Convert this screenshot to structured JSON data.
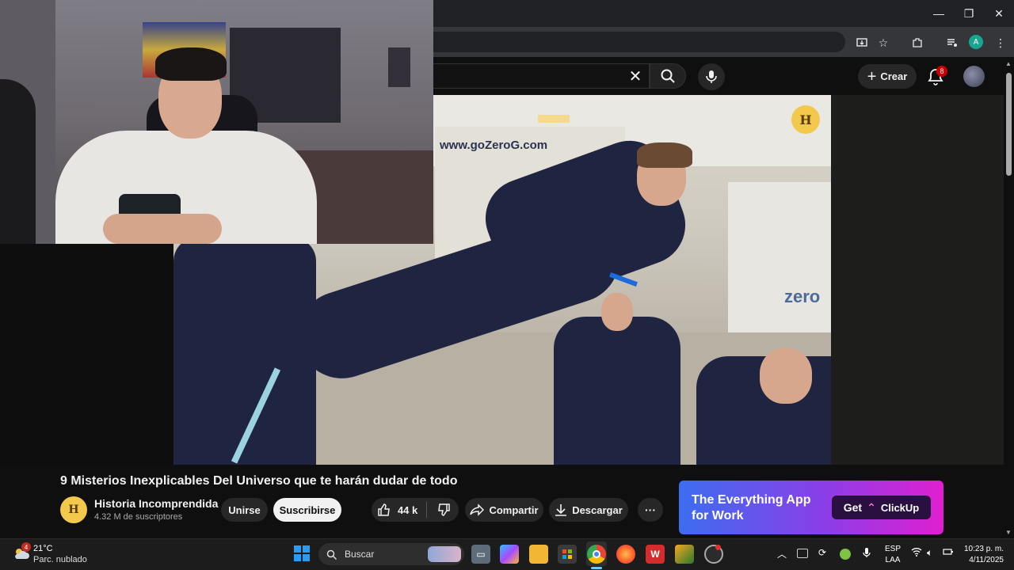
{
  "browser": {
    "controls": [
      "—",
      "❐",
      "✕"
    ],
    "profile_initial": "A"
  },
  "youtube": {
    "create_label": "Crear",
    "notif_count": "8",
    "video_title": "9 Misterios Inexplicables Del Universo que te harán dudar de todo",
    "channel": {
      "name": "Historia Incomprendida",
      "subs": "4.32 M de suscriptores",
      "avatar_letter": "H",
      "join_label": "Unirse",
      "subscribe_label": "Suscribirse"
    },
    "actions": {
      "likes": "44 k",
      "share": "Compartir",
      "download": "Descargar",
      "more": "···"
    },
    "video_overlay": {
      "site_text": "www.goZeroG.com",
      "logo_text": "zero",
      "watermark_letter": "H"
    },
    "ad": {
      "line1": "The Everything App",
      "line2": "for Work",
      "cta_get": "Get",
      "cta_brand": "ClickUp"
    }
  },
  "taskbar": {
    "weather": {
      "temp": "21°C",
      "desc": "Parc. nublado",
      "badge": "4"
    },
    "search_label": "Buscar",
    "lang_line1": "ESP",
    "lang_line2": "LAA",
    "time": "10:23 p. m.",
    "date": "4/11/2025"
  }
}
